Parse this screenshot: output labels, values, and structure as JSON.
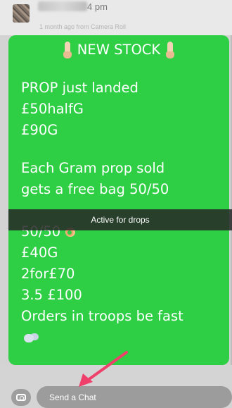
{
  "header": {
    "time": "4 pm",
    "subline": "1 month ago from Camera Roll"
  },
  "message": {
    "title": "NEW STOCK",
    "lines_top": [
      "PROP  just landed",
      "£50halfG",
      "£90G"
    ],
    "lines_mid": [
      "Each Gram prop sold",
      "gets a free bag 50/50"
    ],
    "lines_bottom": [
      "50/50",
      "£40G",
      "2for£70",
      "3.5 £100",
      " Orders in troops be fast"
    ]
  },
  "caption": {
    "text": "Active for drops"
  },
  "chat": {
    "placeholder": "Send a Chat"
  },
  "colors": {
    "bubble": "#2fcf45",
    "arrow": "#ef3f6b"
  },
  "icons": [
    "pointing-down-finger-icon",
    "ok-hand-icon",
    "dash-cloud-icon",
    "camera-icon",
    "arrow-icon"
  ]
}
